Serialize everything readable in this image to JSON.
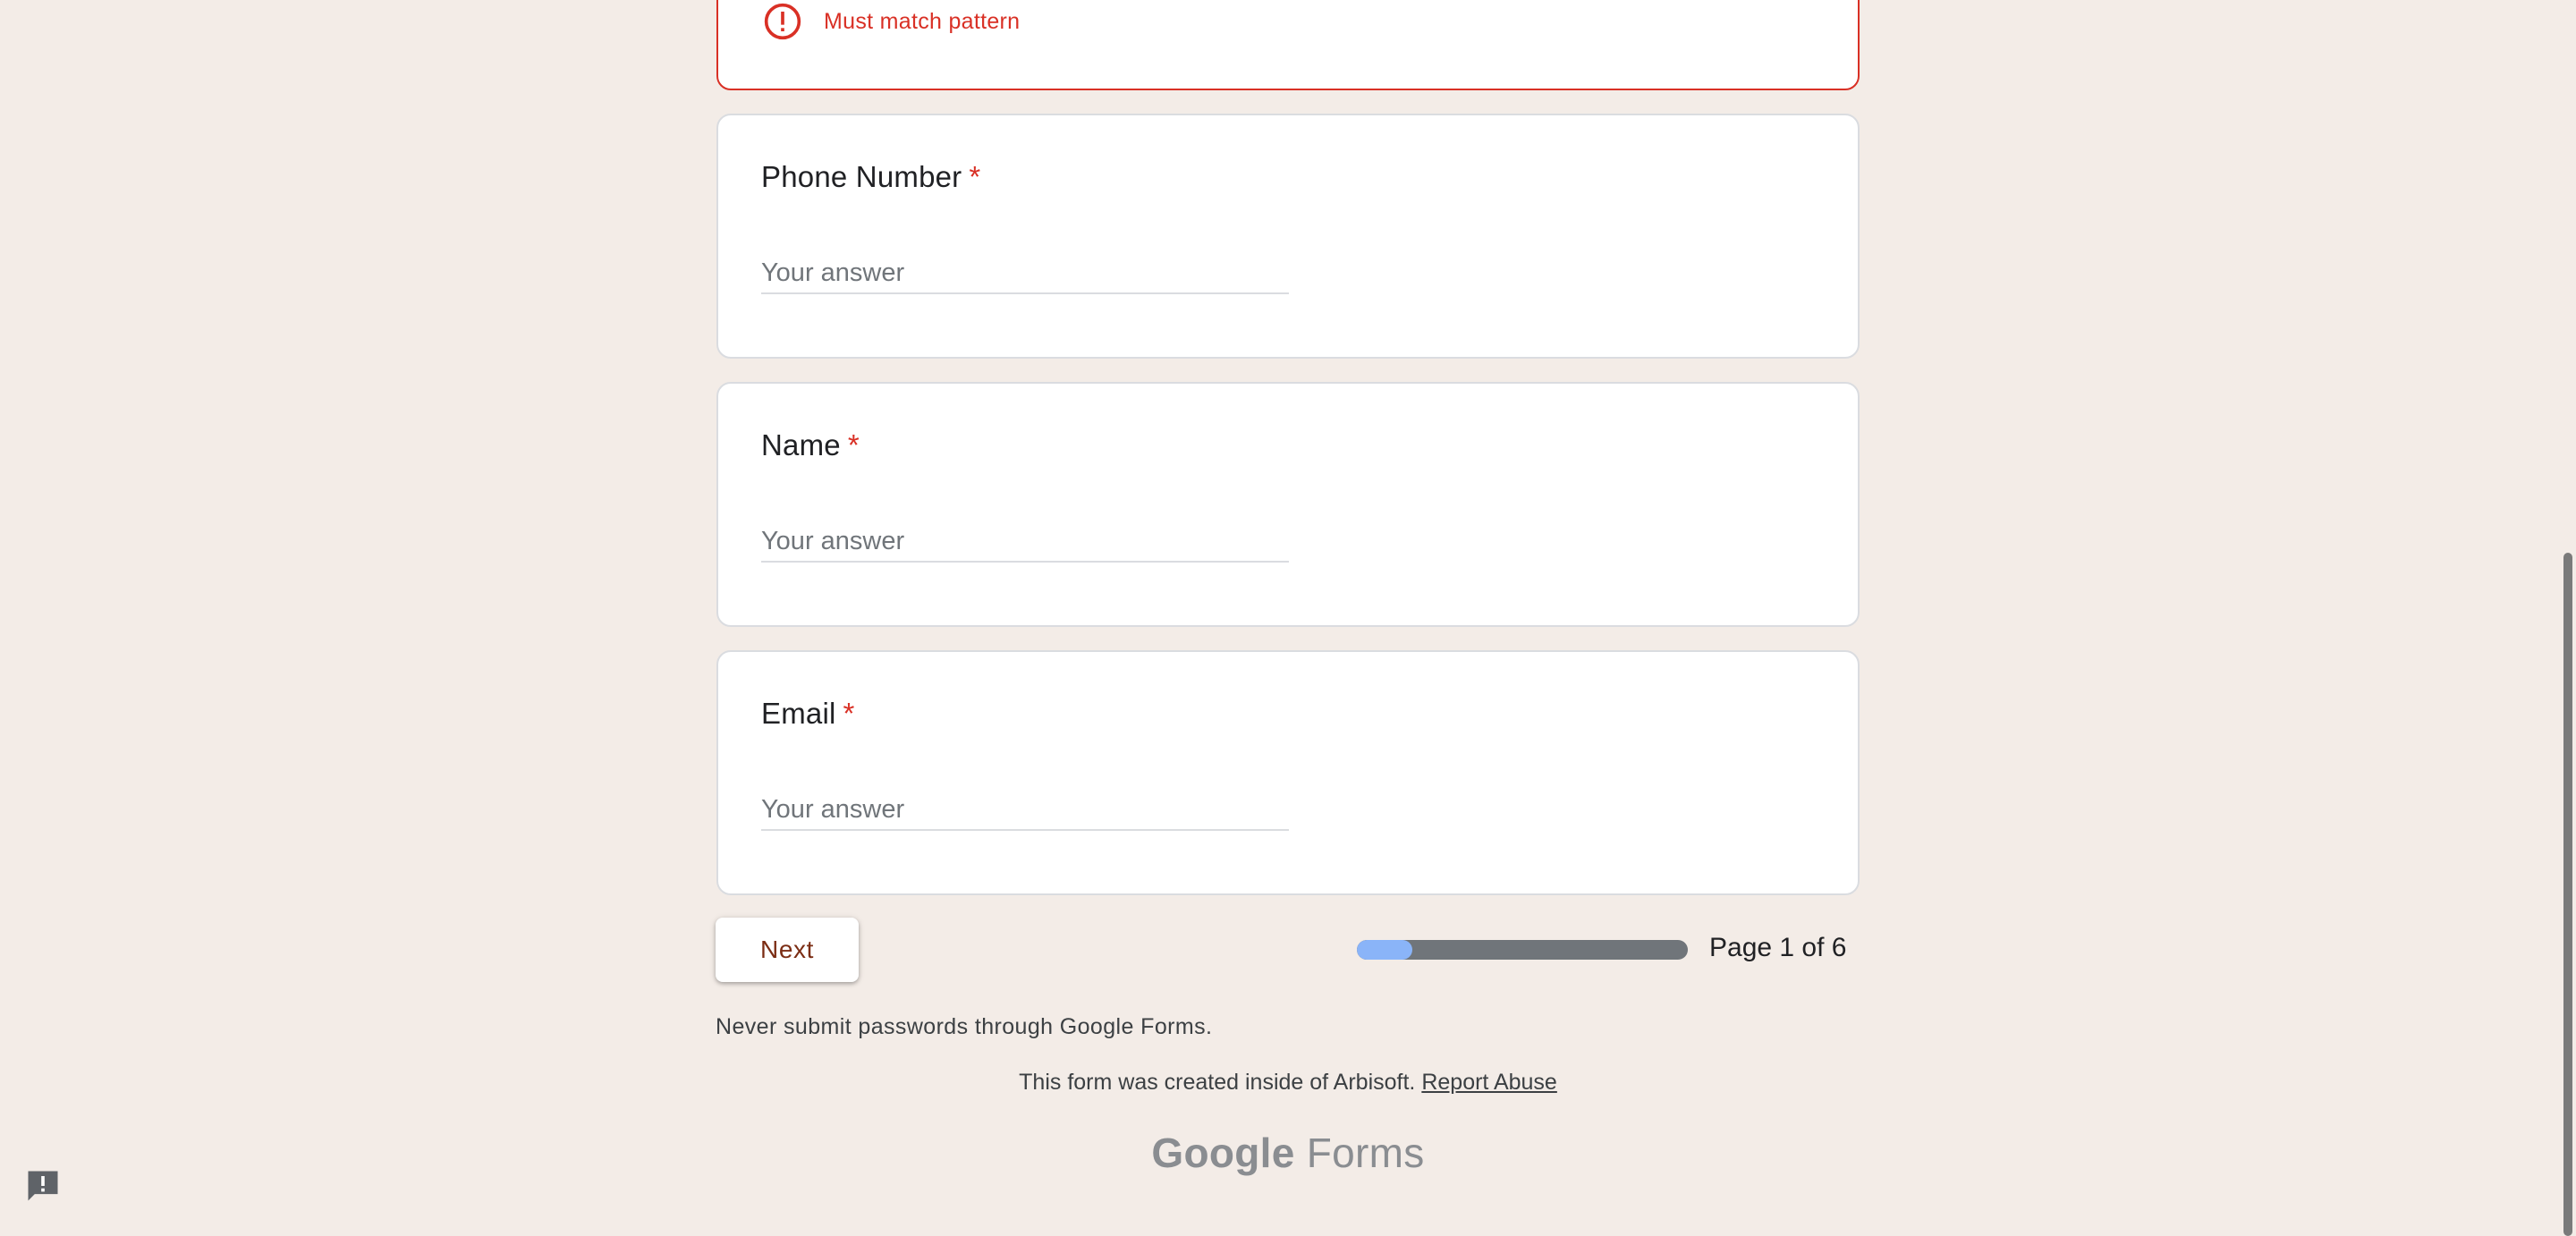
{
  "error_card": {
    "message": "Must match pattern"
  },
  "questions": [
    {
      "title": "Phone Number",
      "required_mark": "*",
      "placeholder": "Your answer",
      "value": ""
    },
    {
      "title": "Name",
      "required_mark": "*",
      "placeholder": "Your answer",
      "value": ""
    },
    {
      "title": "Email",
      "required_mark": "*",
      "placeholder": "Your answer",
      "value": ""
    }
  ],
  "navigation": {
    "next_label": "Next",
    "page_indicator": "Page 1 of 6",
    "progress_fraction": 0.1667
  },
  "footer": {
    "disclaimer": "Never submit passwords through Google Forms.",
    "created_text": "This form was created inside of Arbisoft.",
    "report_link": "Report Abuse",
    "brand_google": "Google",
    "brand_forms": "Forms"
  },
  "colors": {
    "background": "#f3ece7",
    "error": "#d93025",
    "accent_text": "#7b2d14",
    "progress_fill": "#8ab4f8",
    "progress_track": "#70757a"
  },
  "icons": {
    "error": "error-circle-icon",
    "feedback": "feedback-icon"
  }
}
